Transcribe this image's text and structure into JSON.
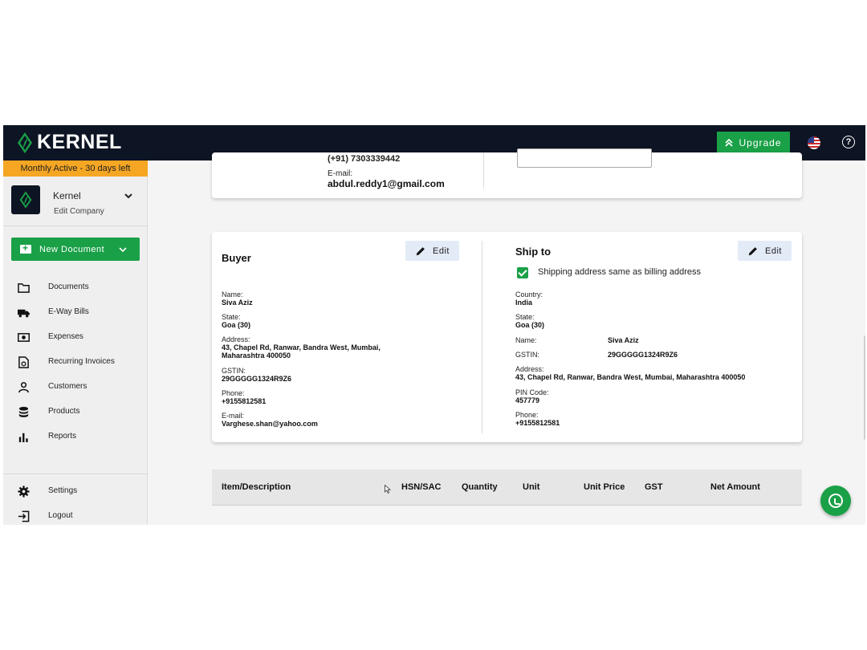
{
  "topbar": {
    "logo_text": "KERNEL",
    "upgrade_label": "Upgrade"
  },
  "sidebar": {
    "trial_banner": "Monthly Active - 30 days left",
    "company_name": "Kernel",
    "company_sub": "Edit Company",
    "new_document_label": "New Document",
    "items": [
      {
        "label": "Documents",
        "icon": "folder-icon"
      },
      {
        "label": "E-Way Bills",
        "icon": "truck-icon"
      },
      {
        "label": "Expenses",
        "icon": "cash-icon"
      },
      {
        "label": "Recurring Invoices",
        "icon": "recurring-invoice-icon"
      },
      {
        "label": "Customers",
        "icon": "person-icon"
      },
      {
        "label": "Products",
        "icon": "database-icon"
      },
      {
        "label": "Reports",
        "icon": "bar-chart-icon"
      }
    ],
    "bottom_items": [
      {
        "label": "Settings",
        "icon": "gear-icon"
      },
      {
        "label": "Logout",
        "icon": "logout-icon"
      }
    ]
  },
  "top_card": {
    "phone": "(+91) 7303339442",
    "email_label": "E-mail:",
    "email": "abdul.reddy1@gmail.com"
  },
  "buyer": {
    "title": "Buyer",
    "edit_label": "Edit",
    "name_label": "Name:",
    "name": "Siva Aziz",
    "state_label": "State:",
    "state": "Goa (30)",
    "address_label": "Address:",
    "address_line1": "43, Chapel Rd, Ranwar, Bandra West, Mumbai,",
    "address_line2": "Maharashtra 400050",
    "gstin_label": "GSTIN:",
    "gstin": "29GGGGG1324R9Z6",
    "phone_label": "Phone:",
    "phone": "+9155812581",
    "email_label": "E-mail:",
    "email": "Varghese.shan@yahoo.com"
  },
  "ship_to": {
    "title": "Ship to",
    "edit_label": "Edit",
    "same_as_billing_label": "Shipping address same as billing address",
    "same_as_billing_checked": true,
    "country_label": "Country:",
    "country": "India",
    "state_label": "State:",
    "state": "Goa (30)",
    "name_label": "Name:",
    "name": "Siva Aziz",
    "gstin_label": "GSTIN:",
    "gstin": "29GGGGG1324R9Z6",
    "address_label": "Address:",
    "address": "43, Chapel Rd, Ranwar, Bandra West, Mumbai, Maharashtra 400050",
    "pin_label": "PIN Code:",
    "pin": "457779",
    "phone_label": "Phone:",
    "phone": "+9155812581"
  },
  "items_table": {
    "columns": [
      "Item/Description",
      "HSN/SAC",
      "Quantity",
      "Unit",
      "Unit Price",
      "GST",
      "Net Amount"
    ]
  },
  "colors": {
    "brand_dark": "#0d1423",
    "accent_green": "#1aa047",
    "trial_orange": "#f5a623",
    "edit_bg": "#e3ebf7"
  }
}
